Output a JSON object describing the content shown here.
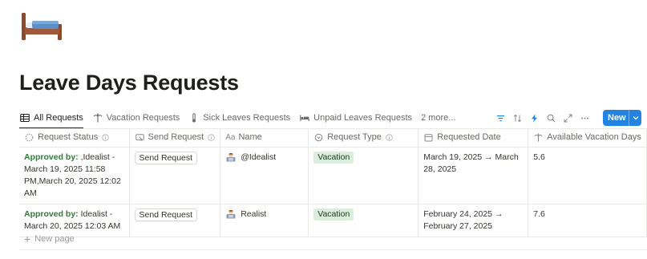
{
  "page": {
    "icon": "bed-icon",
    "title": "Leave Days Requests"
  },
  "views": {
    "tabs": [
      {
        "label": "All Requests",
        "icon": "table-icon",
        "active": true
      },
      {
        "label": "Vacation Requests",
        "icon": "palm-tree-icon",
        "active": false
      },
      {
        "label": "Sick Leaves Requests",
        "icon": "thermometer-icon",
        "active": false
      },
      {
        "label": "Unpaid Leaves Requests",
        "icon": "bed-icon",
        "active": false
      }
    ],
    "more_label": "2 more..."
  },
  "toolbar": {
    "icons": [
      "filter-icon",
      "sort-icon",
      "automation-bolt-icon",
      "search-icon",
      "expand-icon",
      "more-icon"
    ],
    "new_label": "New",
    "accent": "#2383e2"
  },
  "table": {
    "columns": [
      {
        "label": "Request Status",
        "icon": "status-icon"
      },
      {
        "label": "Send Request",
        "icon": "button-icon"
      },
      {
        "label": "Name",
        "icon": "text-aa-icon"
      },
      {
        "label": "Request Type",
        "icon": "select-icon"
      },
      {
        "label": "Requested Date",
        "icon": "calendar-icon"
      },
      {
        "label": "Available Vacation Days",
        "icon": "palm-tree-icon"
      }
    ],
    "rows": [
      {
        "status_prefix": "Approved by:",
        "status_text": " ,Idealist - March 19, 2025 11:58 PM,March 20, 2025 12:02 AM",
        "send_label": "Send Request",
        "name": "@Idealist",
        "type": "Vacation",
        "date": "March 19, 2025 → March 28, 2025",
        "available": "5.6"
      },
      {
        "status_prefix": "Approved by:",
        "status_text": " Idealist - March 20, 2025 12:03 AM",
        "send_label": "Send Request",
        "name": "Realist",
        "type": "Vacation",
        "date": "February 24, 2025 → February 27, 2025",
        "available": "7.6"
      }
    ],
    "new_page_label": "New page"
  },
  "colors": {
    "approved_green": "#2f7d3a",
    "vacation_tag_bg": "#dbeddb"
  }
}
